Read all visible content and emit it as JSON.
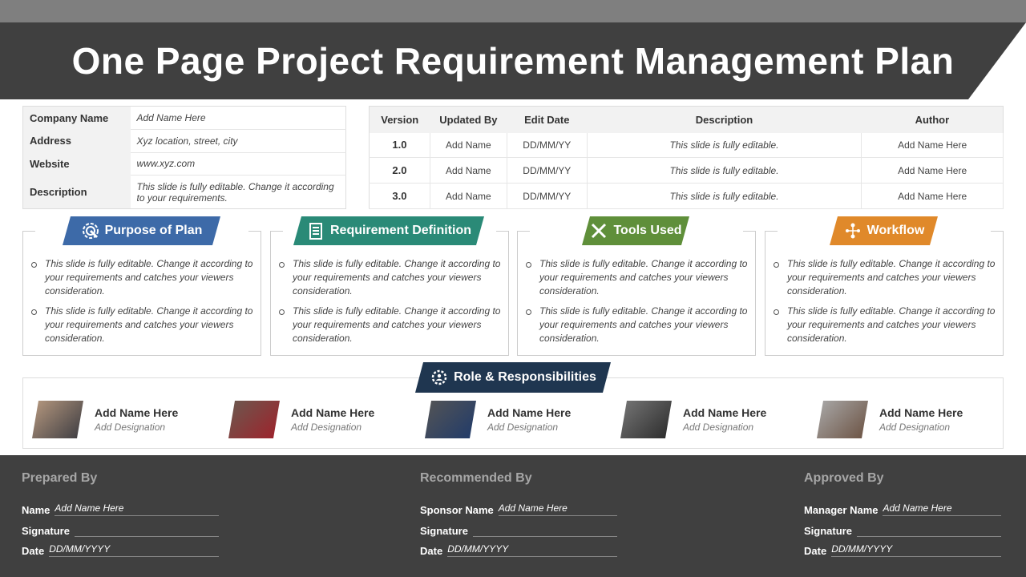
{
  "title": "One Page Project Requirement Management Plan",
  "company": [
    {
      "label": "Company Name",
      "value": "Add Name Here"
    },
    {
      "label": "Address",
      "value": "Xyz location, street, city"
    },
    {
      "label": "Website",
      "value": "www.xyz.com"
    },
    {
      "label": "Description",
      "value": "This slide is fully editable. Change it according to your requirements."
    }
  ],
  "versions": {
    "headers": [
      "Version",
      "Updated By",
      "Edit Date",
      "Description",
      "Author"
    ],
    "rows": [
      [
        "1.0",
        "Add Name",
        "DD/MM/YY",
        "This slide is fully editable.",
        "Add Name Here"
      ],
      [
        "2.0",
        "Add Name",
        "DD/MM/YY",
        "This slide is fully editable.",
        "Add Name Here"
      ],
      [
        "3.0",
        "Add Name",
        "DD/MM/YY",
        "This slide is fully editable.",
        "Add Name Here"
      ]
    ]
  },
  "sections": [
    {
      "title": "Purpose of Plan",
      "icon": "target-icon",
      "color": "#3d6aa8",
      "bullets": [
        "This slide is fully editable. Change it according to your requirements and catches your viewers consideration.",
        "This slide is fully editable. Change it according to your requirements and catches your viewers consideration."
      ]
    },
    {
      "title": "Requirement Definition",
      "icon": "checklist-icon",
      "color": "#2a8a77",
      "bullets": [
        "This slide is fully editable. Change it according to your requirements and catches your viewers consideration.",
        "This slide is fully editable. Change it according to your requirements and catches your viewers consideration."
      ]
    },
    {
      "title": "Tools Used",
      "icon": "tools-icon",
      "color": "#5f8f3a",
      "bullets": [
        "This slide is fully editable. Change it according to your requirements and catches your viewers consideration.",
        "This slide is fully editable. Change it according to your requirements and catches your viewers consideration."
      ]
    },
    {
      "title": "Workflow",
      "icon": "workflow-icon",
      "color": "#e0892a",
      "bullets": [
        "This slide is fully editable. Change it according to your requirements and catches your viewers consideration.",
        "This slide is fully editable. Change it according to your requirements and catches your viewers consideration."
      ]
    }
  ],
  "roles": {
    "title": "Role & Responsibilities",
    "people": [
      {
        "name": "Add Name Here",
        "designation": "Add Designation"
      },
      {
        "name": "Add Name Here",
        "designation": "Add Designation"
      },
      {
        "name": "Add Name Here",
        "designation": "Add Designation"
      },
      {
        "name": "Add Name Here",
        "designation": "Add Designation"
      },
      {
        "name": "Add Name Here",
        "designation": "Add Designation"
      }
    ]
  },
  "footer": [
    {
      "heading": "Prepared By",
      "fields": [
        {
          "label": "Name",
          "value": "Add Name Here"
        },
        {
          "label": "Signature",
          "value": ""
        },
        {
          "label": "Date",
          "value": "DD/MM/YYYY"
        }
      ]
    },
    {
      "heading": "Recommended By",
      "fields": [
        {
          "label": "Sponsor Name",
          "value": "Add Name Here"
        },
        {
          "label": "Signature",
          "value": ""
        },
        {
          "label": "Date",
          "value": "DD/MM/YYYY"
        }
      ]
    },
    {
      "heading": "Approved By",
      "fields": [
        {
          "label": "Manager Name",
          "value": "Add Name Here"
        },
        {
          "label": "Signature",
          "value": ""
        },
        {
          "label": "Date",
          "value": "DD/MM/YYYY"
        }
      ]
    }
  ]
}
